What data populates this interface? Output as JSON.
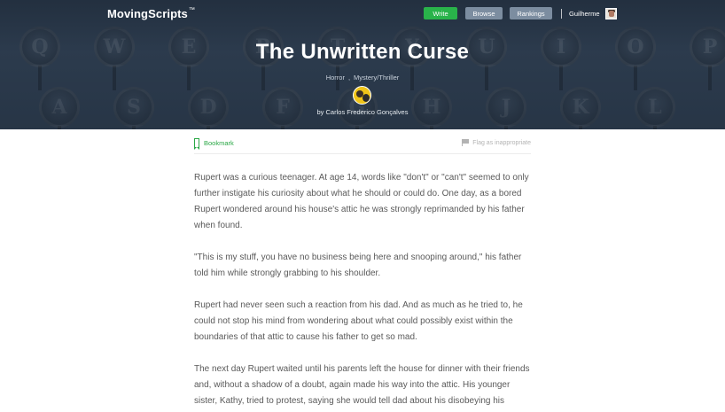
{
  "nav": {
    "logo": "MovingScripts",
    "logo_mark": "™",
    "write_label": "Write",
    "browse_label": "Browse",
    "rankings_label": "Rankings",
    "username": "Guilherme"
  },
  "hero": {
    "keys": [
      "Q",
      "W",
      "E",
      "R",
      "T",
      "Y",
      "U",
      "I",
      "O",
      "P",
      "A",
      "S",
      "D",
      "F",
      "G",
      "H",
      "J",
      "K",
      "L"
    ],
    "title": "The Unwritten Curse",
    "genres": [
      "Horror",
      "Mystery/Thriller"
    ],
    "genre_separator": ",",
    "byline": "by Carlos Frederico Gonçalves"
  },
  "toolbar": {
    "bookmark_label": "Bookmark",
    "flag_label": "Flag as inappropriate"
  },
  "story": {
    "paragraphs": [
      "Rupert was a curious teenager. At age 14, words like \"don't\" or \"can't\" seemed to only further instigate his curiosity about what he should or could do. One day, as a bored Rupert wondered around his house's attic he was strongly reprimanded by his father when found.",
      "\"This is my stuff, you have no business being here and snooping around,\" his father told him while strongly grabbing to his shoulder.",
      "Rupert had never seen such a reaction from his dad. And as much as he tried to, he could not stop his mind from wondering about what could possibly exist within the boundaries of that attic to cause his father to get so mad.",
      "The next day Rupert waited until his parents left the house for dinner with their friends and, without a shadow of a doubt, again made his way into the attic. His younger sister, Kathy, tried to protest, saying she would tell dad about his disobeying his"
    ]
  },
  "colors": {
    "hero_bg": "#2f3f52",
    "accent_green": "#29b34a",
    "nav_button": "#7c8da0"
  }
}
